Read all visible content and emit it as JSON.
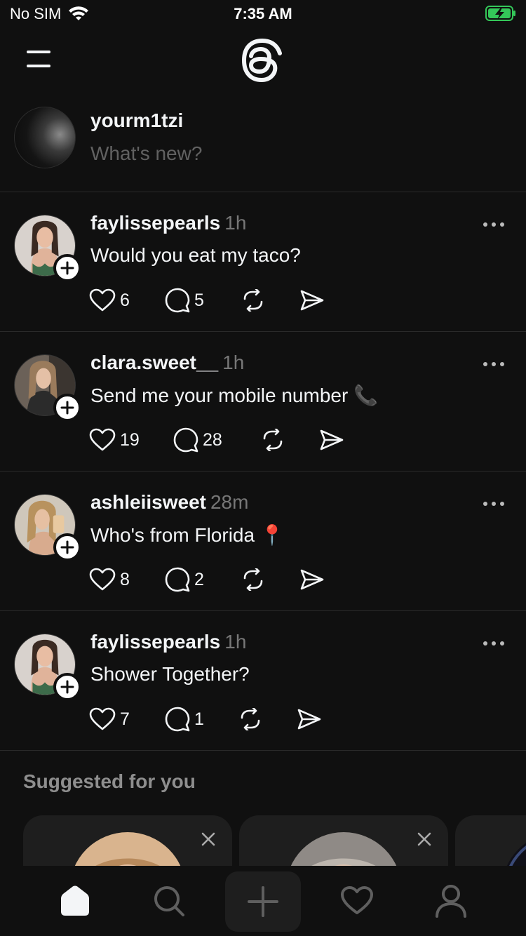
{
  "status_bar": {
    "carrier": "No SIM",
    "time": "7:35 AM"
  },
  "composer": {
    "username": "yourm1tzi",
    "placeholder": "What's new?"
  },
  "posts": [
    {
      "author": "faylissepearls",
      "time": "1h",
      "text": "Would you eat my taco?",
      "likes": "6",
      "replies": "5"
    },
    {
      "author": "clara.sweet__",
      "time": "1h",
      "text": "Send me your mobile number 📞",
      "likes": "19",
      "replies": "28"
    },
    {
      "author": "ashleiisweet",
      "time": "28m",
      "text": "Who's from Florida 📍",
      "likes": "8",
      "replies": "2"
    },
    {
      "author": "faylissepearls",
      "time": "1h",
      "text": "Shower Together?",
      "likes": "7",
      "replies": "1"
    }
  ],
  "suggested": {
    "title": "Suggested for you"
  },
  "tabs": [
    {
      "icon": "home-icon",
      "active": true
    },
    {
      "icon": "search-icon",
      "active": false
    },
    {
      "icon": "plus-icon",
      "active": false
    },
    {
      "icon": "heart-icon",
      "active": false
    },
    {
      "icon": "profile-icon",
      "active": false
    }
  ],
  "colors": {
    "background": "#101010",
    "text": "#f3f5f7",
    "muted": "#777777",
    "battery": "#34c759"
  }
}
